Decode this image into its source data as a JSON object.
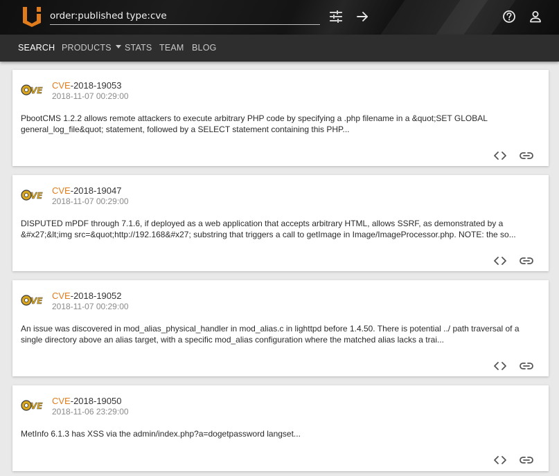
{
  "header": {
    "search": {
      "value": "order:published type:cve",
      "placeholder": ""
    },
    "icons": {
      "logo": "vulners-logo",
      "filters": "tune-sliders-icon",
      "submit": "arrow-right-icon",
      "help": "help-circle-icon",
      "account": "user-icon"
    },
    "accent_color": "#e07c1c"
  },
  "nav": {
    "items": [
      {
        "label": "SEARCH",
        "active": true
      },
      {
        "label": "PRODUCTS",
        "dropdown": true
      },
      {
        "label": "STATS"
      },
      {
        "label": "TEAM"
      },
      {
        "label": "BLOG"
      }
    ]
  },
  "results": [
    {
      "type_prefix": "CVE",
      "id_rest": "-2018-19053",
      "date": "2018-11-07 00:29:00",
      "description": "PbootCMS 1.2.2 allows remote attackers to execute arbitrary PHP code by specifying a .php filename in a &quot;SET GLOBAL general_log_file&quot; statement, followed by a SELECT statement containing this PHP..."
    },
    {
      "type_prefix": "CVE",
      "id_rest": "-2018-19047",
      "date": "2018-11-07 00:29:00",
      "description": "DISPUTED mPDF through 7.1.6, if deployed as a web application that accepts arbitrary HTML, allows SSRF, as demonstrated by a &#x27;&lt;img src=&quot;http://192.168&#x27; substring that triggers a call to getImage in Image/ImageProcessor.php. NOTE: the so..."
    },
    {
      "type_prefix": "CVE",
      "id_rest": "-2018-19052",
      "date": "2018-11-07 00:29:00",
      "description": "An issue was discovered in mod_alias_physical_handler in mod_alias.c in lighttpd before 1.4.50. There is potential ../ path traversal of a single directory above an alias target, with a specific mod_alias configuration where the matched alias lacks a trai..."
    },
    {
      "type_prefix": "CVE",
      "id_rest": "-2018-19050",
      "date": "2018-11-06 23:29:00",
      "description": "MetInfo 6.1.3 has XSS via the admin/index.php?a=dogetpassword langset..."
    }
  ],
  "card_actions": {
    "source_icon": "code-brackets-icon",
    "link_icon": "link-icon"
  }
}
